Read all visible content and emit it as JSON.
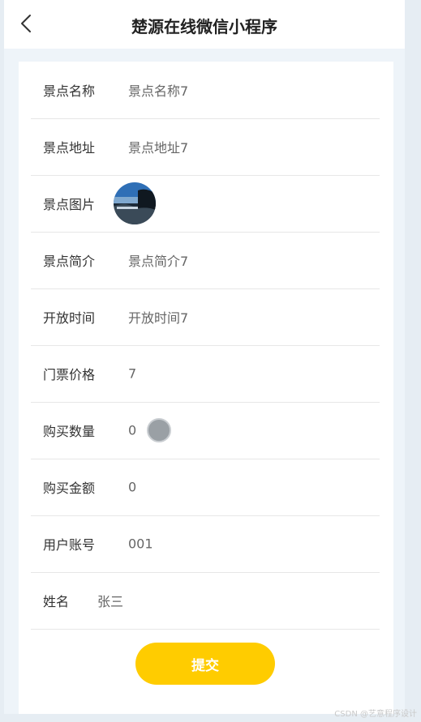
{
  "header": {
    "title": "楚源在线微信小程序",
    "back_icon": "chevron-left-icon"
  },
  "form": {
    "rows": [
      {
        "label": "景点名称",
        "value": "景点名称7"
      },
      {
        "label": "景点地址",
        "value": "景点地址7"
      },
      {
        "label": "景点图片",
        "value": ""
      },
      {
        "label": "景点简介",
        "value": "景点简介7"
      },
      {
        "label": "开放时间",
        "value": "开放时间7"
      },
      {
        "label": "门票价格",
        "value": "7"
      },
      {
        "label": "购买数量",
        "value": "0"
      },
      {
        "label": "购买金额",
        "value": "0"
      },
      {
        "label": "用户账号",
        "value": "001"
      },
      {
        "label": "姓名",
        "value": "张三"
      }
    ],
    "submit_label": "提交"
  },
  "watermark": "CSDN @艺意程序设计",
  "colors": {
    "accent": "#ffcc00",
    "page_bg": "#eef4f9"
  }
}
